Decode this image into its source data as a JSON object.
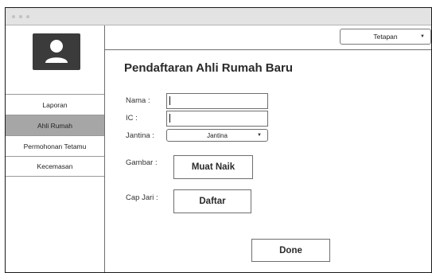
{
  "sidebar": {
    "items": [
      {
        "label": "Laporan"
      },
      {
        "label": "Ahli Rumah"
      },
      {
        "label": "Permohonan Tetamu"
      },
      {
        "label": "Kecemasan"
      }
    ]
  },
  "header": {
    "dropdown_value": "Tetapan"
  },
  "form": {
    "title": "Pendaftaran Ahli Rumah Baru",
    "nama_label": "Nama :",
    "nama_value": "",
    "ic_label": "IC :",
    "ic_value": "",
    "jantina_label": "Jantina :",
    "jantina_value": "Jantina",
    "gambar_label": "Gambar :",
    "upload_button": "Muat Naik",
    "capjari_label": "Cap Jari :",
    "register_button": "Daftar",
    "done_button": "Done"
  }
}
